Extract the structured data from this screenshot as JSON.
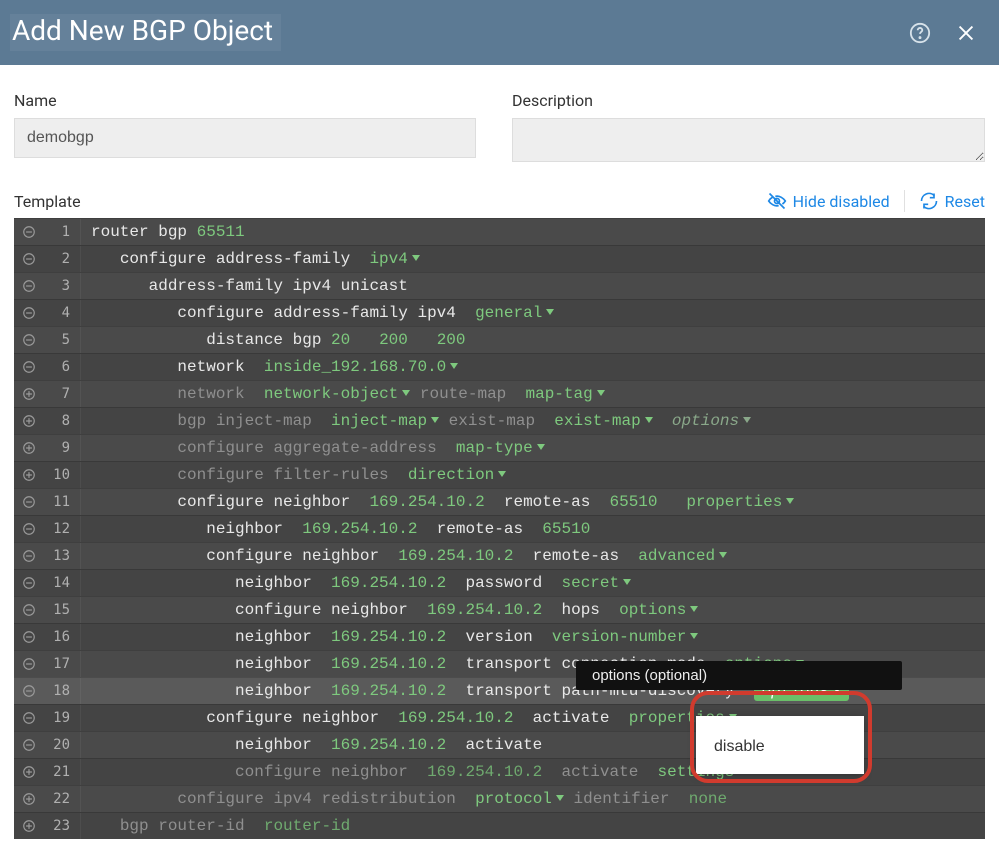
{
  "header": {
    "title": "Add New BGP Object"
  },
  "form": {
    "name_label": "Name",
    "name_value": "demobgp",
    "desc_label": "Description",
    "desc_value": ""
  },
  "template_bar": {
    "label": "Template",
    "hide_disabled": "Hide disabled",
    "reset": "Reset"
  },
  "tooltip": "options (optional)",
  "dropdown": {
    "item1": "disable"
  },
  "rows": [
    {
      "n": 1,
      "icon": "minus",
      "alt": false,
      "indent": 0,
      "segments": [
        {
          "t": "router bgp ",
          "c": "kw"
        },
        {
          "t": "65511",
          "c": "num"
        }
      ]
    },
    {
      "n": 2,
      "icon": "minus",
      "alt": true,
      "indent": 1,
      "segments": [
        {
          "t": "configure address-family  ",
          "c": "kw"
        },
        {
          "t": "ipv4",
          "c": "dd chev"
        }
      ]
    },
    {
      "n": 3,
      "icon": "minus",
      "alt": false,
      "indent": 2,
      "segments": [
        {
          "t": "address-family ipv4 unicast",
          "c": "kw"
        }
      ]
    },
    {
      "n": 4,
      "icon": "minus",
      "alt": true,
      "indent": 3,
      "segments": [
        {
          "t": "configure address-family ipv4  ",
          "c": "kw"
        },
        {
          "t": "general",
          "c": "dd chev"
        }
      ]
    },
    {
      "n": 5,
      "icon": "minus",
      "alt": false,
      "indent": 4,
      "segments": [
        {
          "t": "distance bgp ",
          "c": "kw"
        },
        {
          "t": "20",
          "c": "num"
        },
        {
          "t": "   ",
          "c": "kw"
        },
        {
          "t": "200",
          "c": "num"
        },
        {
          "t": "   ",
          "c": "kw"
        },
        {
          "t": "200",
          "c": "num"
        }
      ]
    },
    {
      "n": 6,
      "icon": "minus",
      "alt": true,
      "indent": 3,
      "segments": [
        {
          "t": "network  ",
          "c": "kw"
        },
        {
          "t": "inside_192.168.70.0",
          "c": "dd chev var"
        }
      ]
    },
    {
      "n": 7,
      "icon": "plus",
      "alt": false,
      "indent": 3,
      "segments": [
        {
          "t": "network  ",
          "c": "dim"
        },
        {
          "t": "network-object",
          "c": "dd chev dimv"
        },
        {
          "t": " route-map  ",
          "c": "dim"
        },
        {
          "t": "map-tag",
          "c": "dd chev dimv"
        }
      ]
    },
    {
      "n": 8,
      "icon": "plus",
      "alt": true,
      "indent": 3,
      "segments": [
        {
          "t": "bgp inject-map  ",
          "c": "dim"
        },
        {
          "t": "inject-map",
          "c": "dd chev dimv"
        },
        {
          "t": " exist-map  ",
          "c": "dim"
        },
        {
          "t": "exist-map",
          "c": "dd chev dimv"
        },
        {
          "t": "  ",
          "c": "dim"
        },
        {
          "t": "options",
          "c": "dd chev opt dim"
        }
      ]
    },
    {
      "n": 9,
      "icon": "plus",
      "alt": false,
      "indent": 3,
      "segments": [
        {
          "t": "configure aggregate-address  ",
          "c": "dim"
        },
        {
          "t": "map-type",
          "c": "dd chev dimv"
        }
      ]
    },
    {
      "n": 10,
      "icon": "plus",
      "alt": true,
      "indent": 3,
      "segments": [
        {
          "t": "configure filter-rules  ",
          "c": "dim"
        },
        {
          "t": "direction",
          "c": "dd chev dimv"
        }
      ]
    },
    {
      "n": 11,
      "icon": "minus",
      "alt": false,
      "indent": 3,
      "segments": [
        {
          "t": "configure neighbor  ",
          "c": "kw"
        },
        {
          "t": "169.254.10.2",
          "c": "var"
        },
        {
          "t": "  remote-as  ",
          "c": "kw"
        },
        {
          "t": "65510",
          "c": "num"
        },
        {
          "t": "   ",
          "c": "kw"
        },
        {
          "t": "properties",
          "c": "dd chev"
        }
      ]
    },
    {
      "n": 12,
      "icon": "minus",
      "alt": true,
      "indent": 4,
      "segments": [
        {
          "t": "neighbor  ",
          "c": "kw"
        },
        {
          "t": "169.254.10.2",
          "c": "var"
        },
        {
          "t": "  remote-as  ",
          "c": "kw"
        },
        {
          "t": "65510",
          "c": "num"
        }
      ]
    },
    {
      "n": 13,
      "icon": "minus",
      "alt": false,
      "indent": 4,
      "segments": [
        {
          "t": "configure neighbor  ",
          "c": "kw"
        },
        {
          "t": "169.254.10.2",
          "c": "var"
        },
        {
          "t": "  remote-as  ",
          "c": "kw"
        },
        {
          "t": "advanced",
          "c": "dd chev"
        }
      ]
    },
    {
      "n": 14,
      "icon": "minus",
      "alt": true,
      "indent": 5,
      "segments": [
        {
          "t": "neighbor  ",
          "c": "kw"
        },
        {
          "t": "169.254.10.2",
          "c": "var"
        },
        {
          "t": "  password  ",
          "c": "kw"
        },
        {
          "t": "secret",
          "c": "dd chev"
        }
      ]
    },
    {
      "n": 15,
      "icon": "minus",
      "alt": false,
      "indent": 5,
      "segments": [
        {
          "t": "configure neighbor  ",
          "c": "kw"
        },
        {
          "t": "169.254.10.2",
          "c": "var"
        },
        {
          "t": "  hops  ",
          "c": "kw"
        },
        {
          "t": "options",
          "c": "dd chev"
        }
      ]
    },
    {
      "n": 16,
      "icon": "minus",
      "alt": true,
      "indent": 5,
      "segments": [
        {
          "t": "neighbor  ",
          "c": "kw"
        },
        {
          "t": "169.254.10.2",
          "c": "var"
        },
        {
          "t": "  version  ",
          "c": "kw"
        },
        {
          "t": "version-number",
          "c": "dd chev"
        }
      ]
    },
    {
      "n": 17,
      "icon": "minus",
      "alt": false,
      "indent": 5,
      "segments": [
        {
          "t": "neighbor  ",
          "c": "kw"
        },
        {
          "t": "169.254.10.2",
          "c": "var"
        },
        {
          "t": "  transport connection-mode  ",
          "c": "kw"
        },
        {
          "t": "options",
          "c": "dd chev"
        }
      ]
    },
    {
      "n": 18,
      "icon": "minus",
      "alt": true,
      "indent": 5,
      "highlight": true,
      "segments": [
        {
          "t": "neighbor  ",
          "c": "kw"
        },
        {
          "t": "169.254.10.2",
          "c": "var"
        },
        {
          "t": "  transport path-mtu-discovery  ",
          "c": "kw"
        },
        {
          "t": "options",
          "c": "dd chev pill-open",
          "id": "options-pill"
        }
      ]
    },
    {
      "n": 19,
      "icon": "minus",
      "alt": true,
      "indent": 4,
      "segments": [
        {
          "t": "configure neighbor  ",
          "c": "kw"
        },
        {
          "t": "169.254.10.2",
          "c": "var"
        },
        {
          "t": "  activate  ",
          "c": "kw"
        },
        {
          "t": "properties",
          "c": "dd chev"
        }
      ]
    },
    {
      "n": 20,
      "icon": "minus",
      "alt": false,
      "indent": 5,
      "segments": [
        {
          "t": "neighbor  ",
          "c": "kw"
        },
        {
          "t": "169.254.10.2",
          "c": "var"
        },
        {
          "t": "  activate",
          "c": "kw"
        }
      ]
    },
    {
      "n": 21,
      "icon": "plus",
      "alt": true,
      "indent": 5,
      "segments": [
        {
          "t": "configure neighbor  ",
          "c": "dim"
        },
        {
          "t": "169.254.10.2",
          "c": "dimv"
        },
        {
          "t": "  activate  ",
          "c": "dim"
        },
        {
          "t": "settings",
          "c": "dd chev dimv"
        }
      ]
    },
    {
      "n": 22,
      "icon": "plus",
      "alt": false,
      "indent": 3,
      "segments": [
        {
          "t": "configure ipv4 redistribution  ",
          "c": "dim"
        },
        {
          "t": "protocol",
          "c": "dd chev dimv"
        },
        {
          "t": " identifier  ",
          "c": "dim"
        },
        {
          "t": "none",
          "c": "dimv"
        }
      ]
    },
    {
      "n": 23,
      "icon": "plus",
      "alt": true,
      "indent": 1,
      "segments": [
        {
          "t": "bgp router-id  ",
          "c": "dim"
        },
        {
          "t": "router-id",
          "c": "dimv"
        }
      ]
    }
  ]
}
